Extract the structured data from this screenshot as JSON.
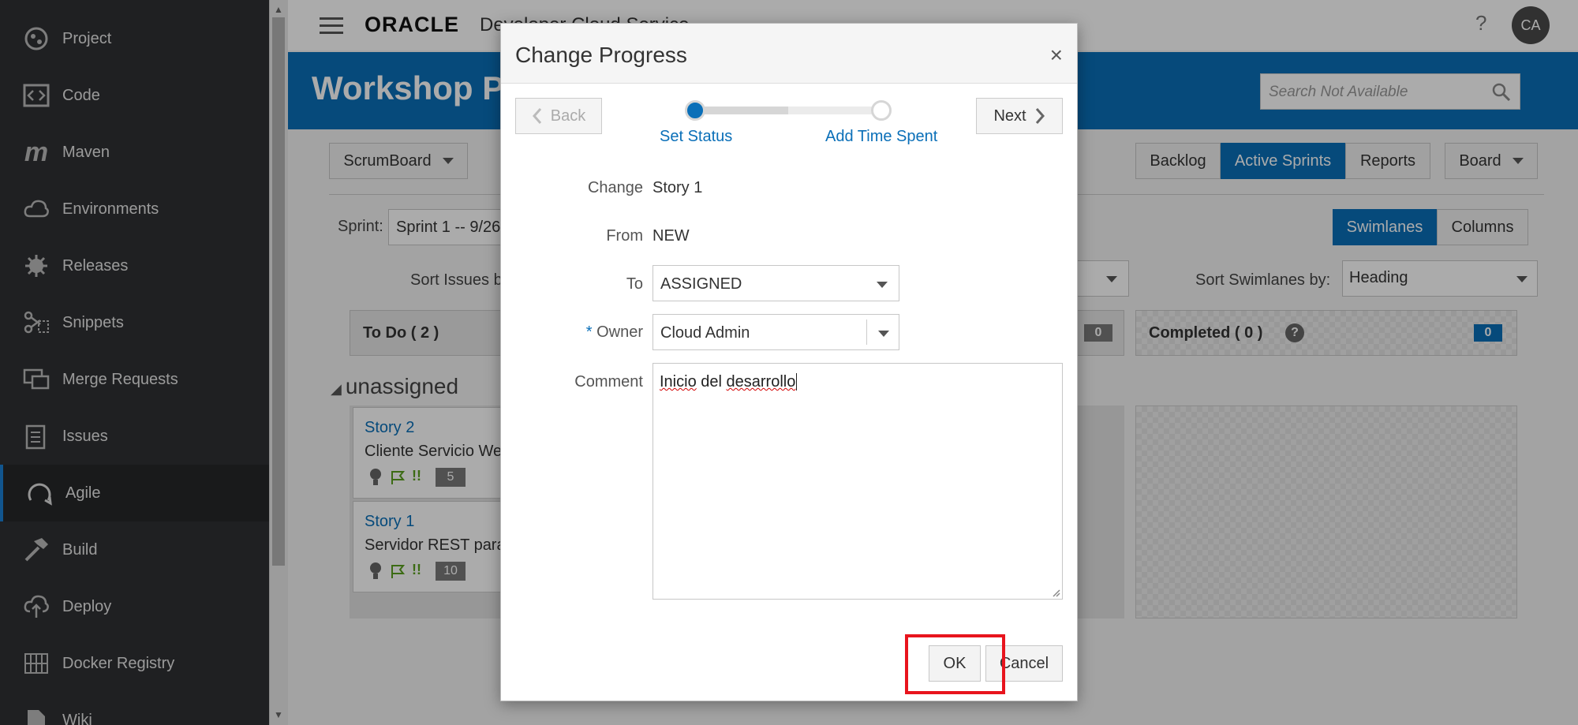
{
  "sidebar": {
    "items": [
      {
        "label": "Project",
        "icon": "project-icon"
      },
      {
        "label": "Code",
        "icon": "code-icon"
      },
      {
        "label": "Maven",
        "icon": "maven-icon"
      },
      {
        "label": "Environments",
        "icon": "cloud-icon"
      },
      {
        "label": "Releases",
        "icon": "releases-icon"
      },
      {
        "label": "Snippets",
        "icon": "scissors-icon"
      },
      {
        "label": "Merge Requests",
        "icon": "merge-requests-icon"
      },
      {
        "label": "Issues",
        "icon": "issues-icon"
      },
      {
        "label": "Agile",
        "icon": "agile-icon",
        "active": true
      },
      {
        "label": "Build",
        "icon": "hammer-icon"
      },
      {
        "label": "Deploy",
        "icon": "deploy-icon"
      },
      {
        "label": "Docker Registry",
        "icon": "docker-icon"
      },
      {
        "label": "Wiki",
        "icon": "wiki-icon"
      }
    ]
  },
  "header": {
    "logo": "ORACLE",
    "product": "Developer Cloud Service",
    "help": "?",
    "avatar": "CA"
  },
  "banner": {
    "title": "Workshop P",
    "search_placeholder": "Search Not Available"
  },
  "board": {
    "scrumboard_label": "ScrumBoard",
    "tabs": [
      "Backlog",
      "Active Sprints",
      "Reports",
      "Board"
    ],
    "active_tab": "Active Sprints",
    "view_toggle": [
      "Swimlanes",
      "Columns"
    ],
    "sprint_label": "Sprint:",
    "sprint_value": "Sprint 1 -- 9/26",
    "sort_issues_label": "Sort Issues b",
    "sort_swimlanes_label": "Sort Swimlanes by:",
    "sort_swimlanes_value": "Heading",
    "todo_header": "To Do ( 2 )",
    "inprogress_count": "0",
    "completed_header": "Completed ( 0 )",
    "completed_count": "0",
    "swimlane": "unassigned",
    "cards": [
      {
        "id": "Story 2",
        "title": "Cliente Servicio We",
        "points": "5"
      },
      {
        "id": "Story 1",
        "title": "Servidor REST para",
        "points": "10"
      }
    ]
  },
  "dialog": {
    "title": "Change Progress",
    "close": "×",
    "back": "Back",
    "next": "Next",
    "steps": [
      "Set Status",
      "Add Time Spent"
    ],
    "fields": {
      "change_label": "Change",
      "change_value": "Story 1",
      "from_label": "From",
      "from_value": "NEW",
      "to_label": "To",
      "to_value": "ASSIGNED",
      "owner_required": "*",
      "owner_label": "Owner",
      "owner_value": "Cloud Admin",
      "comment_label": "Comment",
      "comment_words": [
        "Inicio",
        "del",
        "desarrollo"
      ]
    },
    "ok": "OK",
    "cancel": "Cancel"
  },
  "colors": {
    "accent": "#0a6fb8",
    "sidebar_bg": "#2f3133",
    "highlight": "#e8141d"
  }
}
